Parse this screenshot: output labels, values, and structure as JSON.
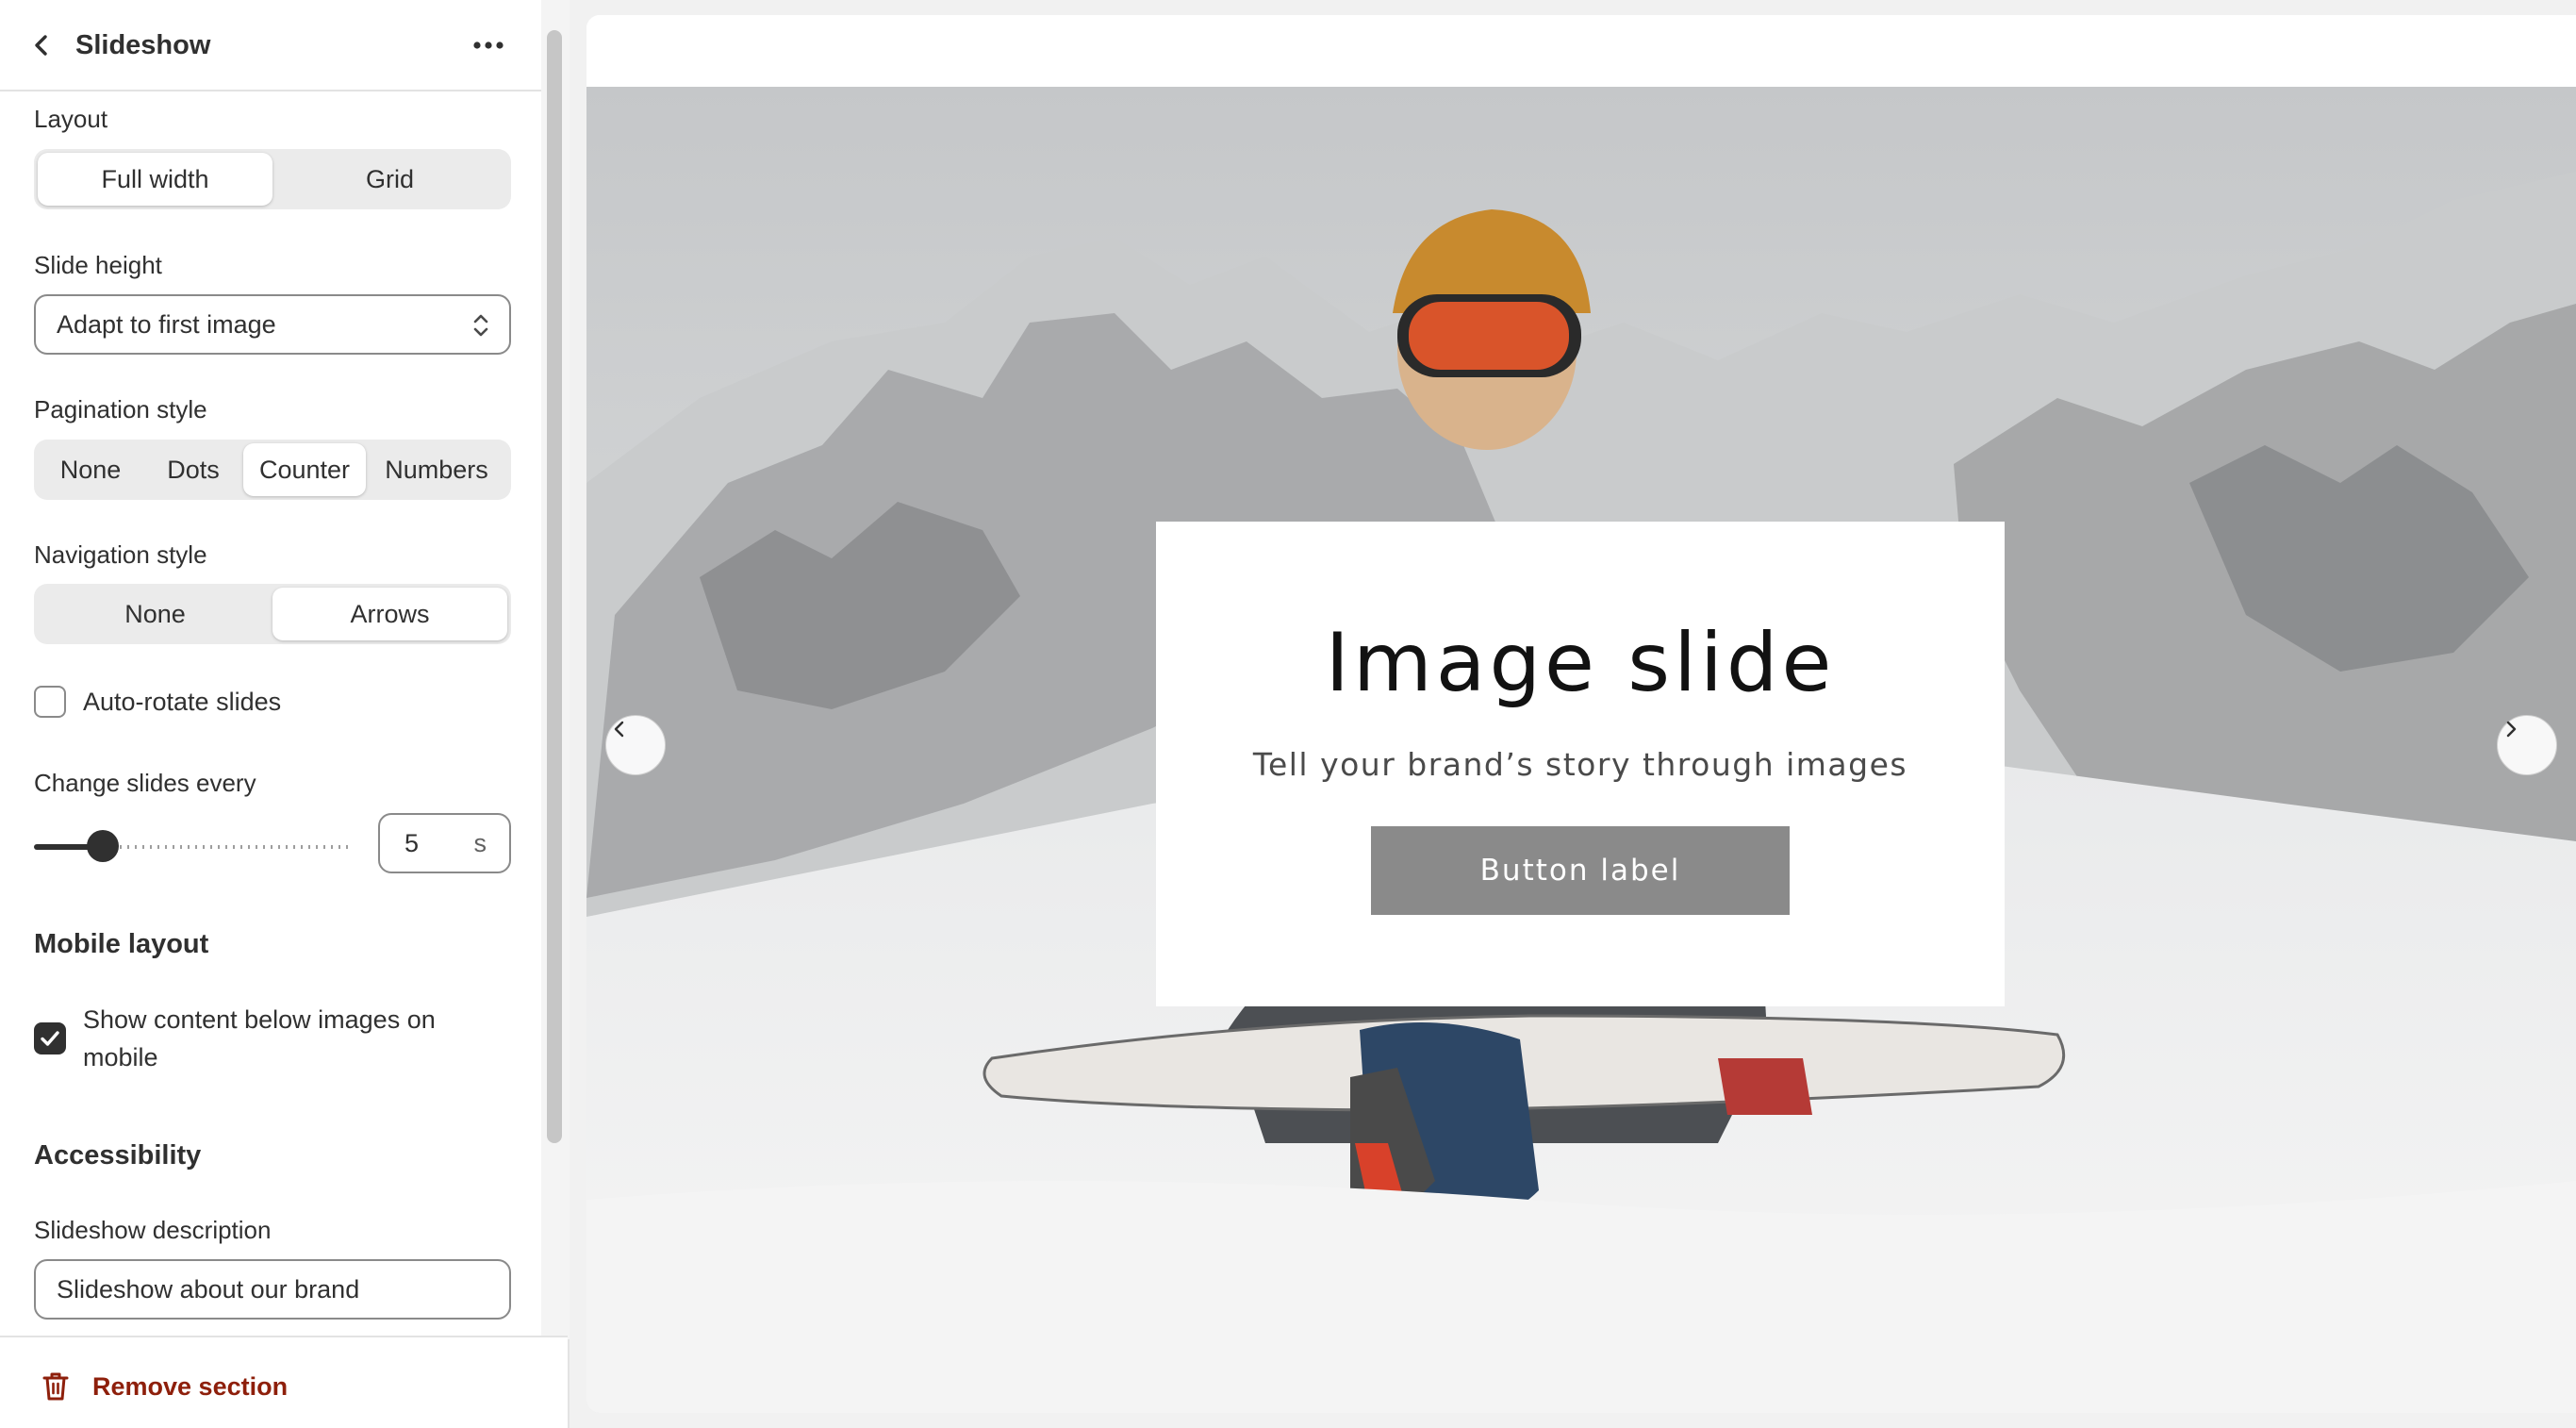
{
  "sidebar": {
    "title": "Slideshow",
    "layout": {
      "label": "Layout",
      "options": [
        "Full width",
        "Grid"
      ],
      "selected": "Full width"
    },
    "slide_height": {
      "label": "Slide height",
      "value": "Adapt to first image"
    },
    "pagination": {
      "label": "Pagination style",
      "options": [
        "None",
        "Dots",
        "Counter",
        "Numbers"
      ],
      "selected": "Counter"
    },
    "navigation": {
      "label": "Navigation style",
      "options": [
        "None",
        "Arrows"
      ],
      "selected": "Arrows"
    },
    "auto_rotate": {
      "label": "Auto-rotate slides",
      "checked": false
    },
    "change_slides": {
      "label": "Change slides every",
      "value": "5",
      "unit": "s",
      "slider_fraction": 0.22
    },
    "mobile_layout": {
      "heading": "Mobile layout",
      "show_below": {
        "label": "Show content below images on mobile",
        "checked": true
      }
    },
    "accessibility": {
      "heading": "Accessibility",
      "description": {
        "label": "Slideshow description",
        "value": "Slideshow about our brand"
      }
    },
    "remove_label": "Remove section"
  },
  "preview": {
    "slide": {
      "heading": "Image slide",
      "subheading": "Tell your brand’s story through images",
      "button_label": "Button label"
    }
  },
  "colors": {
    "text": "#303030",
    "danger": "#8e1f0b",
    "slide_button": "#8a8a8a"
  }
}
